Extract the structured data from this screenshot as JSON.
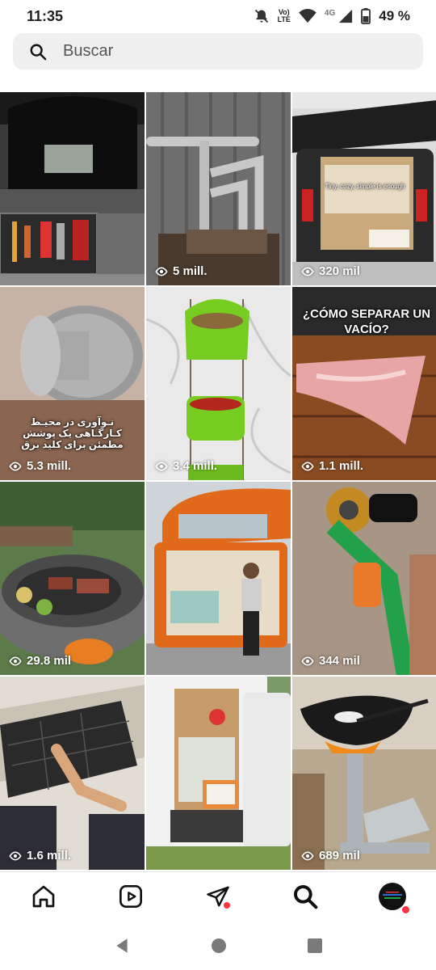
{
  "status_bar": {
    "time": "11:35",
    "lte_top": "Vo)",
    "lte_bottom": "LTE",
    "network": "4G",
    "battery": "49 %"
  },
  "search": {
    "placeholder": "Buscar"
  },
  "grid": {
    "tiles": [
      {
        "views": ""
      },
      {
        "views": "5 mill."
      },
      {
        "views": "320 mil",
        "caption": "Tiny, cozy, simple is enough"
      },
      {
        "views": "5.3 mill.",
        "caption": "نـوآوری در محیـط کـارگـاهی یک پوشش مطمئن برای کلید برق"
      },
      {
        "views": "3.4 mill."
      },
      {
        "views": "1.1 mill.",
        "caption": "¿CÓMO SEPARAR UN VACÍO?"
      },
      {
        "views": "29.8 mil"
      },
      {
        "views": ""
      },
      {
        "views": "344 mil"
      },
      {
        "views": "1.6 mill."
      },
      {
        "views": ""
      },
      {
        "views": "689 mil"
      }
    ]
  },
  "nav": [
    "home-icon",
    "reels-icon",
    "send-icon",
    "search-icon",
    "profile-avatar"
  ],
  "colors": {
    "notification_dot": "#ff3040",
    "search_bg": "#efefef"
  }
}
